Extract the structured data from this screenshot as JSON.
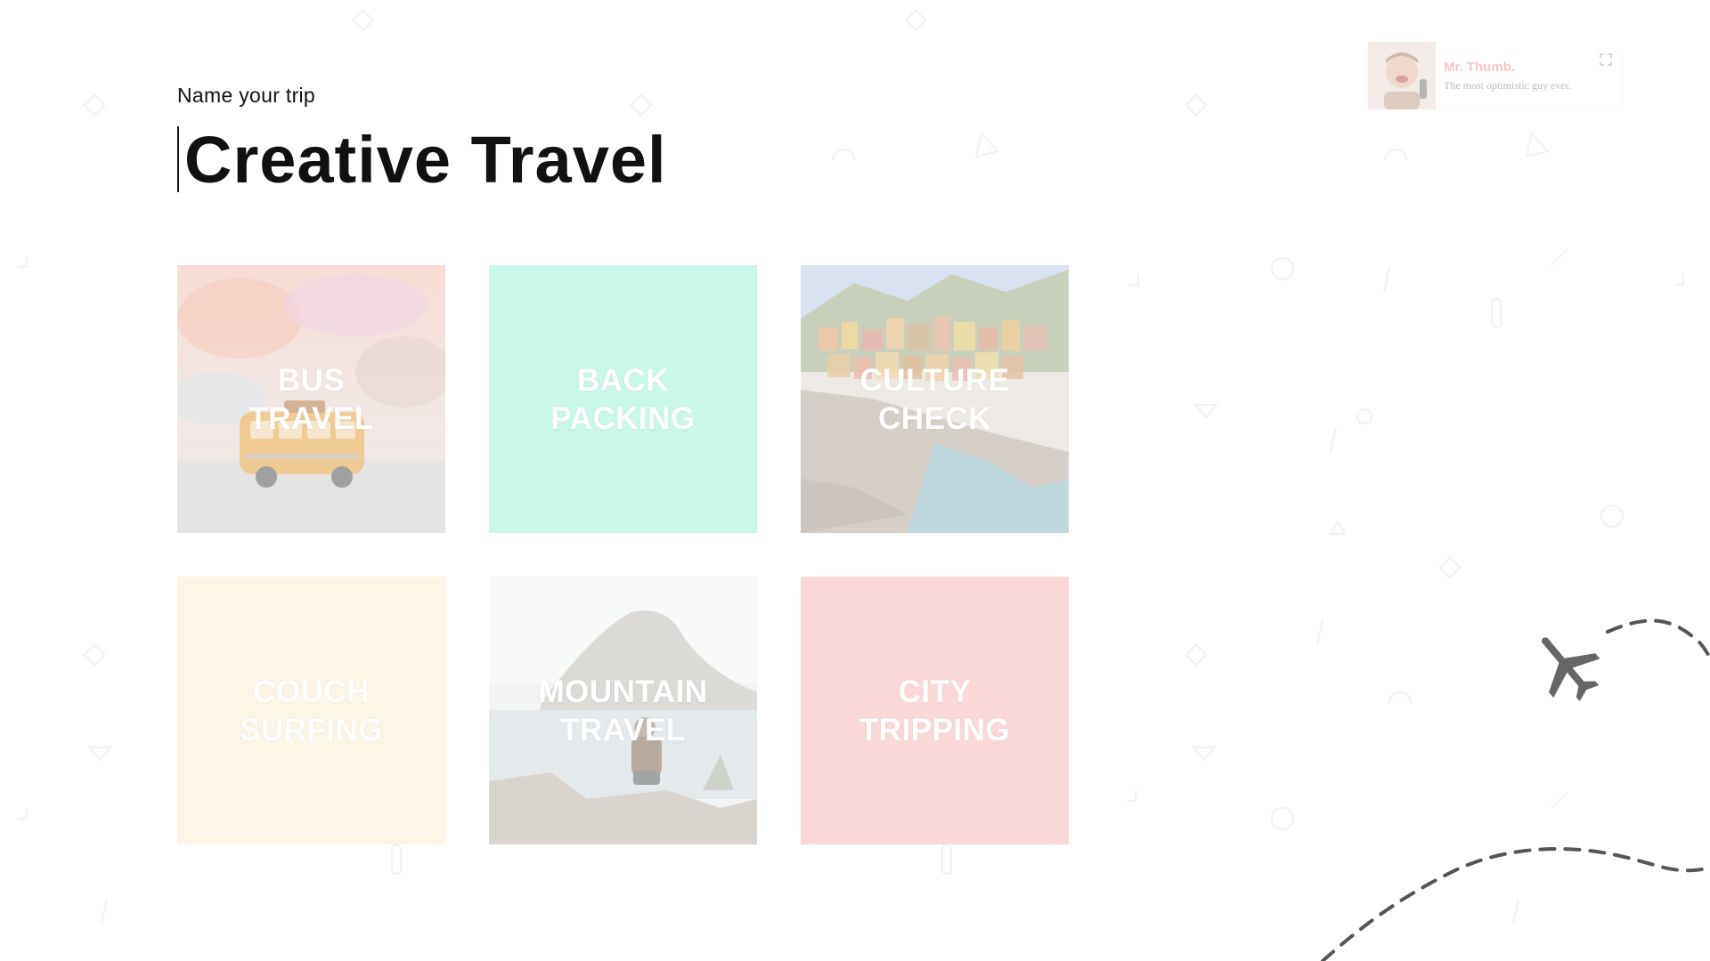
{
  "header": {
    "eyebrow": "Name your trip",
    "title": "Creative Travel"
  },
  "tiles": [
    {
      "label": "BUS\nTRAVEL",
      "kind": "photo-bus"
    },
    {
      "label": "BACK\nPACKING",
      "kind": "solid",
      "color": "#c9f7ea"
    },
    {
      "label": "CULTURE\nCHECK",
      "kind": "photo-village"
    },
    {
      "label": "COUCH\nSURFING",
      "kind": "solid",
      "color": "#fdf6e6"
    },
    {
      "label": "MOUNTAIN\nTRAVEL",
      "kind": "photo-mountain"
    },
    {
      "label": "CITY\nTRIPPING",
      "kind": "solid",
      "color": "#fbd8d8"
    }
  ],
  "profile": {
    "name": "Mr. Thumb.",
    "tagline": "The most optimistic guy ever."
  },
  "icons": {
    "plane": "airplane-icon",
    "expand": "expand-icon"
  }
}
